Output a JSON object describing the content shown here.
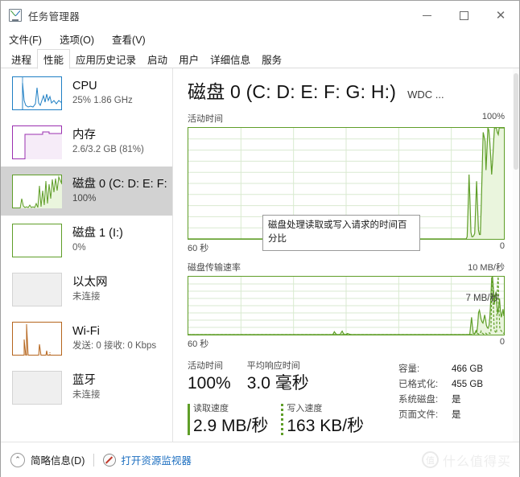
{
  "window": {
    "title": "任务管理器",
    "icon": "task-manager-icon",
    "minimize": "—",
    "maximize": "□",
    "close": "✕"
  },
  "menu": [
    {
      "label": "文件(F)"
    },
    {
      "label": "选项(O)"
    },
    {
      "label": "查看(V)"
    }
  ],
  "tabs": [
    {
      "label": "进程",
      "active": false
    },
    {
      "label": "性能",
      "active": true
    },
    {
      "label": "应用历史记录",
      "active": false
    },
    {
      "label": "启动",
      "active": false
    },
    {
      "label": "用户",
      "active": false
    },
    {
      "label": "详细信息",
      "active": false
    },
    {
      "label": "服务",
      "active": false
    }
  ],
  "sidebar": {
    "items": [
      {
        "title": "CPU",
        "sub": "25% 1.86 GHz",
        "color": "#1f7fc4",
        "selected": false,
        "empty": false
      },
      {
        "title": "内存",
        "sub": "2.6/3.2 GB (81%)",
        "color": "#9b30b0",
        "selected": false,
        "empty": false
      },
      {
        "title": "磁盘 0 (C: D: E: F:",
        "sub": "100%",
        "color": "#5f9e28",
        "selected": true,
        "empty": false
      },
      {
        "title": "磁盘 1 (I:)",
        "sub": "0%",
        "color": "#5f9e28",
        "selected": false,
        "empty": true
      },
      {
        "title": "以太网",
        "sub": "未连接",
        "color": "#c0c0c0",
        "selected": false,
        "empty": true
      },
      {
        "title": "Wi-Fi",
        "sub": "发送: 0 接收: 0 Kbps",
        "color": "#b5651d",
        "selected": false,
        "empty": false
      },
      {
        "title": "蓝牙",
        "sub": "未连接",
        "color": "#c0c0c0",
        "selected": false,
        "empty": true
      }
    ]
  },
  "main": {
    "title": "磁盘 0 (C: D: E: F: G: H:)",
    "model": "WDC ...",
    "tooltip": "磁盘处理读取或写入请求的时间百分比"
  },
  "chart_data": [
    {
      "type": "area",
      "title": "活动时间",
      "ylabel": "活动时间",
      "xlabel": "60 秒",
      "ymax_label": "100%",
      "ymin_label": "0",
      "x_left_label": "60 秒",
      "ylim": [
        0,
        100
      ],
      "grid": true,
      "color": "#5f9e28",
      "fill": "#eaf5dd",
      "values": [
        0,
        0,
        0,
        0,
        0,
        0,
        0,
        0,
        0,
        0,
        0,
        0,
        0,
        0,
        0,
        0,
        0,
        0,
        0,
        0,
        0,
        0,
        0,
        0,
        0,
        0,
        0,
        0,
        0,
        0,
        0,
        0,
        0,
        0,
        0,
        0,
        0,
        0,
        0,
        0,
        0,
        0,
        0,
        0,
        0,
        0,
        0,
        0,
        0,
        0,
        0,
        0,
        0,
        0,
        0,
        0,
        0,
        0,
        0,
        0,
        0,
        0,
        0,
        0,
        0,
        0,
        0,
        0,
        0,
        0,
        0,
        0,
        0,
        0,
        0,
        0,
        0,
        0,
        0,
        0,
        0,
        0,
        0,
        0,
        0,
        0,
        0,
        0,
        0,
        0,
        0,
        0,
        0,
        0,
        0,
        0,
        0,
        0,
        0,
        0,
        0,
        0,
        0,
        0,
        0,
        0,
        0,
        0,
        0,
        0,
        0,
        0,
        0,
        0,
        0,
        0,
        0,
        0,
        0,
        0,
        0,
        0,
        0,
        0,
        0,
        0,
        0,
        0,
        0,
        0,
        0,
        0,
        0,
        0,
        0,
        0,
        0,
        0,
        0,
        0,
        0,
        0,
        0,
        0,
        0,
        0,
        0,
        0,
        0,
        0,
        0,
        0,
        0,
        0,
        0,
        0,
        0,
        0,
        0,
        0,
        0,
        0,
        0,
        0,
        0,
        0,
        3,
        20,
        6,
        1,
        0,
        0,
        0,
        0,
        0,
        0,
        0,
        0,
        0,
        0,
        0,
        0,
        0,
        0,
        0,
        0,
        0,
        0,
        0,
        0,
        0,
        0,
        0,
        0,
        0,
        0,
        0,
        0,
        0,
        0,
        0,
        0,
        0,
        0,
        0,
        0,
        0,
        0,
        0,
        0,
        0,
        0,
        0,
        0,
        0,
        0,
        0,
        0,
        0,
        0,
        0,
        0,
        0,
        0,
        0,
        0,
        0,
        0,
        0,
        0,
        0,
        0,
        0,
        0,
        0,
        0,
        0,
        0,
        0,
        0,
        0,
        0,
        0,
        0,
        0,
        0,
        0,
        0,
        0,
        0,
        0,
        0,
        0,
        0,
        0,
        0,
        0,
        0,
        0,
        0,
        0,
        0,
        0,
        0,
        0,
        0,
        0,
        0,
        0,
        0,
        0,
        0,
        0,
        0,
        0,
        0,
        0,
        0,
        0,
        0,
        0,
        0,
        0,
        0,
        0,
        0,
        0,
        0,
        0,
        0,
        0,
        0,
        0,
        0,
        0,
        0,
        2,
        28,
        58,
        34,
        6,
        2,
        2,
        3,
        5,
        28,
        52,
        30,
        8,
        4,
        4,
        32,
        64,
        96,
        92,
        88,
        62,
        80,
        100,
        98,
        88,
        74,
        58,
        70,
        86,
        100,
        100,
        100,
        96,
        94,
        100,
        100,
        100,
        100,
        100,
        100
      ]
    },
    {
      "type": "area",
      "title": "磁盘传输速率",
      "ylabel": "磁盘传输速率",
      "xlabel": "60 秒",
      "ymax_label": "10 MB/秒",
      "ymin_label": "0",
      "x_left_label": "60 秒",
      "annotation": "7 MB/秒",
      "ylim": [
        0,
        10
      ],
      "grid": true,
      "color": "#5f9e28",
      "fill": "#eaf5dd",
      "series": [
        {
          "name": "读取速度",
          "style": "solid",
          "values": [
            0,
            0,
            0,
            0,
            0,
            0,
            0,
            0,
            0,
            0,
            0,
            0,
            0,
            0,
            0,
            0,
            0,
            0,
            0,
            0,
            0,
            0,
            0,
            0,
            0,
            0,
            0,
            0,
            0,
            0,
            0,
            0,
            0,
            0,
            0,
            0,
            0,
            0,
            0,
            0,
            0,
            0,
            0,
            0,
            0,
            0,
            0,
            0,
            0,
            0,
            0,
            0,
            0,
            0,
            0,
            0,
            0,
            0,
            0,
            0,
            0,
            0,
            0,
            0,
            0,
            0,
            0,
            0,
            0,
            0,
            0,
            0,
            0,
            0,
            0,
            0,
            0,
            0,
            0,
            0,
            0,
            0,
            0,
            0,
            0,
            0,
            0,
            0,
            0,
            0,
            0,
            0,
            0,
            0,
            0,
            0,
            0,
            0,
            0,
            0,
            0,
            0,
            0,
            0,
            0,
            0,
            0,
            0,
            0,
            0,
            0,
            0,
            0,
            0,
            0,
            0,
            0,
            0,
            0,
            0,
            0,
            0,
            0,
            0,
            0,
            0,
            0,
            0,
            0,
            0,
            0,
            0,
            0,
            0,
            0,
            0,
            0,
            0,
            0,
            0,
            0,
            0,
            0,
            0,
            0,
            0,
            0,
            0,
            0,
            0,
            0,
            0,
            0,
            0,
            0,
            0,
            0,
            0,
            0,
            0,
            0,
            0,
            0,
            0,
            0,
            0,
            0.2,
            0.5,
            0.3,
            0.1,
            0,
            0,
            0,
            0,
            0.1,
            0.4,
            0.6,
            0.3,
            0.1,
            0,
            0,
            0.1,
            0.2,
            0.15,
            0.1,
            0.05,
            0,
            0,
            0,
            0,
            0,
            0,
            0,
            0,
            0,
            0,
            0,
            0,
            0,
            0,
            0,
            0,
            0,
            0,
            0,
            0,
            0,
            0,
            0,
            0,
            0,
            0,
            0,
            0,
            0,
            0,
            0,
            0,
            0,
            0,
            0,
            0,
            0,
            0,
            0,
            0,
            0,
            0,
            0,
            0,
            0,
            0,
            0,
            0,
            0,
            0,
            0,
            0,
            0,
            0,
            0,
            0,
            0,
            0,
            0,
            0,
            0,
            0,
            0,
            0,
            0,
            0,
            0,
            0,
            0,
            0,
            0,
            0,
            0,
            0,
            0,
            0,
            0,
            0,
            0,
            0,
            0,
            0,
            0,
            0,
            0,
            0,
            0,
            0,
            0,
            0,
            0,
            0,
            0,
            0,
            0,
            0,
            0,
            0,
            0,
            0,
            0,
            0,
            0,
            0,
            0,
            0,
            0,
            0,
            0,
            0,
            0,
            0,
            0,
            0,
            0,
            0,
            0,
            0,
            0,
            0,
            0,
            0,
            0,
            0,
            0,
            0,
            0,
            0,
            0,
            0,
            0,
            0,
            0,
            0,
            0,
            0,
            0.1,
            1.6,
            3.0,
            1.4,
            0.2,
            0.1,
            0.3,
            0.7,
            0.4,
            1.6,
            3.8,
            4.2,
            3.4,
            2.6,
            2.2,
            2.0,
            2.6,
            3.4,
            2.6,
            1.6,
            1.2,
            1.1,
            1.6,
            3.2,
            6.0,
            9.8,
            10.0,
            8.0,
            5.2,
            6.6,
            7.4,
            5.0,
            3.6,
            4.8,
            6.2,
            4.2,
            3.0,
            3.6,
            4.4,
            3.2
          ]
        },
        {
          "name": "写入速度",
          "style": "dashed",
          "values": [
            0,
            0,
            0,
            0,
            0,
            0,
            0,
            0,
            0,
            0,
            0,
            0,
            0,
            0,
            0,
            0,
            0,
            0,
            0,
            0,
            0,
            0,
            0,
            0,
            0,
            0,
            0,
            0,
            0,
            0,
            0,
            0,
            0,
            0,
            0,
            0,
            0,
            0,
            0,
            0,
            0,
            0,
            0,
            0,
            0,
            0,
            0,
            0,
            0,
            0,
            0,
            0,
            0,
            0,
            0,
            0,
            0,
            0,
            0,
            0,
            0,
            0,
            0,
            0,
            0,
            0,
            0,
            0,
            0,
            0,
            0,
            0,
            0,
            0,
            0,
            0,
            0,
            0,
            0,
            0,
            0,
            0,
            0,
            0,
            0,
            0,
            0,
            0,
            0,
            0,
            0,
            0,
            0,
            0,
            0,
            0,
            0,
            0,
            0,
            0,
            0,
            0,
            0,
            0,
            0,
            0,
            0,
            0,
            0,
            0,
            0,
            0,
            0,
            0,
            0,
            0,
            0,
            0,
            0,
            0,
            0,
            0,
            0,
            0,
            0,
            0,
            0,
            0,
            0,
            0,
            0,
            0,
            0,
            0,
            0,
            0,
            0,
            0,
            0,
            0,
            0,
            0,
            0,
            0,
            0,
            0,
            0,
            0,
            0,
            0,
            0,
            0,
            0,
            0,
            0,
            0,
            0,
            0,
            0,
            0,
            0,
            0,
            0,
            0,
            0,
            0,
            0,
            0,
            0,
            0,
            0,
            0,
            0,
            0,
            0,
            0,
            0,
            0,
            0,
            0,
            0,
            0,
            0,
            0,
            0,
            0,
            0,
            0,
            0,
            0,
            0,
            0,
            0,
            0,
            0,
            0,
            0,
            0,
            0,
            0,
            0,
            0,
            0,
            0,
            0,
            0,
            0,
            0,
            0,
            0,
            0,
            0,
            0,
            0,
            0,
            0,
            0,
            0,
            0,
            0,
            0,
            0,
            0,
            0,
            0,
            0,
            0,
            0,
            0,
            0,
            0,
            0,
            0,
            0,
            0,
            0,
            0,
            0,
            0,
            0,
            0,
            0,
            0,
            0,
            0,
            0,
            0,
            0,
            0,
            0,
            0,
            0,
            0,
            0,
            0,
            0,
            0,
            0,
            0,
            0,
            0,
            0,
            0,
            0,
            0,
            0,
            0,
            0,
            0,
            0,
            0,
            0,
            0,
            0,
            0,
            0,
            0,
            0,
            0,
            0,
            0,
            0,
            0,
            0,
            0,
            0,
            0,
            0,
            0,
            0,
            0,
            0,
            0,
            0,
            0,
            0,
            0,
            0,
            0,
            0,
            0,
            0,
            0,
            0,
            0,
            0,
            0,
            0,
            0,
            0,
            0,
            0,
            0,
            0,
            0,
            0,
            0,
            0,
            0,
            0,
            0,
            0,
            0,
            0,
            0,
            0,
            0,
            0,
            0,
            0,
            0,
            0,
            0,
            0,
            0,
            0,
            0,
            0,
            0,
            0,
            0,
            0,
            0,
            0,
            0,
            0,
            0,
            0,
            0,
            0,
            0,
            0.1,
            0.2,
            0.3,
            0.2,
            0.1,
            0.2,
            0.1,
            0.1,
            0.2,
            0.6,
            0.3,
            0.2,
            0.1,
            0.2,
            0.3,
            0.2,
            0.1,
            0.1,
            0.2,
            0.3,
            0.2,
            0.5,
            7.2,
            10.0,
            5.0,
            1.0,
            0.6,
            0.4,
            0.3,
            8.6,
            10.0,
            4.0,
            1.2,
            0.8,
            0.6,
            0.4,
            0.3,
            0.2
          ]
        }
      ]
    }
  ],
  "stats": {
    "active_time_label": "活动时间",
    "active_time_value": "100%",
    "avg_response_label": "平均响应时间",
    "avg_response_value": "3.0 毫秒",
    "read_label": "读取速度",
    "read_value": "2.9 MB/秒",
    "write_label": "写入速度",
    "write_value": "163 KB/秒",
    "info": [
      {
        "key": "容量:",
        "value": "466 GB"
      },
      {
        "key": "已格式化:",
        "value": "455 GB"
      },
      {
        "key": "系统磁盘:",
        "value": "是"
      },
      {
        "key": "页面文件:",
        "value": "是"
      }
    ]
  },
  "statusbar": {
    "fewer_details": "简略信息(D)",
    "chevron": "⌃",
    "resource_monitor": "打开资源监视器",
    "watermark": "什么值得买",
    "watermark_logo": "值"
  }
}
